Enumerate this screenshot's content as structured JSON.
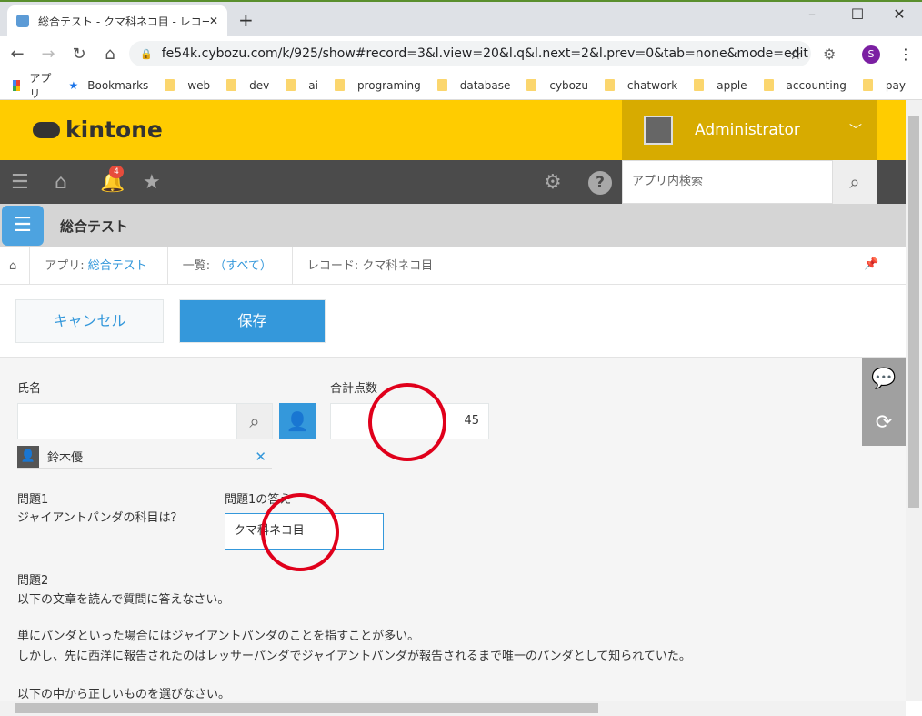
{
  "browser": {
    "tab_title": "総合テスト - クマ科ネコ目 - レコードの",
    "url": "fe54k.cybozu.com/k/925/show#record=3&l.view=20&l.q&l.next=2&l.prev=0&tab=none&mode=edit",
    "profile_initial": "S",
    "bookmarks": [
      "アプリ",
      "Bookmarks",
      "web",
      "dev",
      "ai",
      "programing",
      "database",
      "cybozu",
      "chatwork",
      "apple",
      "accounting",
      "pay"
    ]
  },
  "header": {
    "logo": "kintone",
    "user": "Administrator",
    "notification_count": "4",
    "search_placeholder": "アプリ内検索"
  },
  "app": {
    "title": "総合テスト"
  },
  "breadcrumb": {
    "app_prefix": "アプリ: ",
    "app": "総合テスト",
    "list_prefix": "一覧: ",
    "list": "（すべて）",
    "record": "レコード: クマ科ネコ目"
  },
  "toolbar": {
    "cancel": "キャンセル",
    "save": "保存"
  },
  "form": {
    "name_label": "氏名",
    "selected_user": "鈴木優",
    "total_label": "合計点数",
    "total_value": "45",
    "q1_label": "問題1",
    "q1_text": "ジャイアントパンダの科目は？",
    "a1_label": "問題1の答え",
    "a1_value": "クマ科ネコ目",
    "q2_label": "問題2",
    "q2_lines": [
      "以下の文章を読んで質問に答えなさい。",
      "単にパンダといった場合にはジャイアントパンダのことを指すことが多い。",
      "しかし、先に西洋に報告されたのはレッサーパンダでジャイアントパンダが報告されるまで唯一のパンダとして知られていた。",
      "以下の中から正しいものを選びなさい。"
    ]
  },
  "colors": {
    "brand": "#ffcc00",
    "accent": "#3498db",
    "annotation": "#e0001b"
  }
}
